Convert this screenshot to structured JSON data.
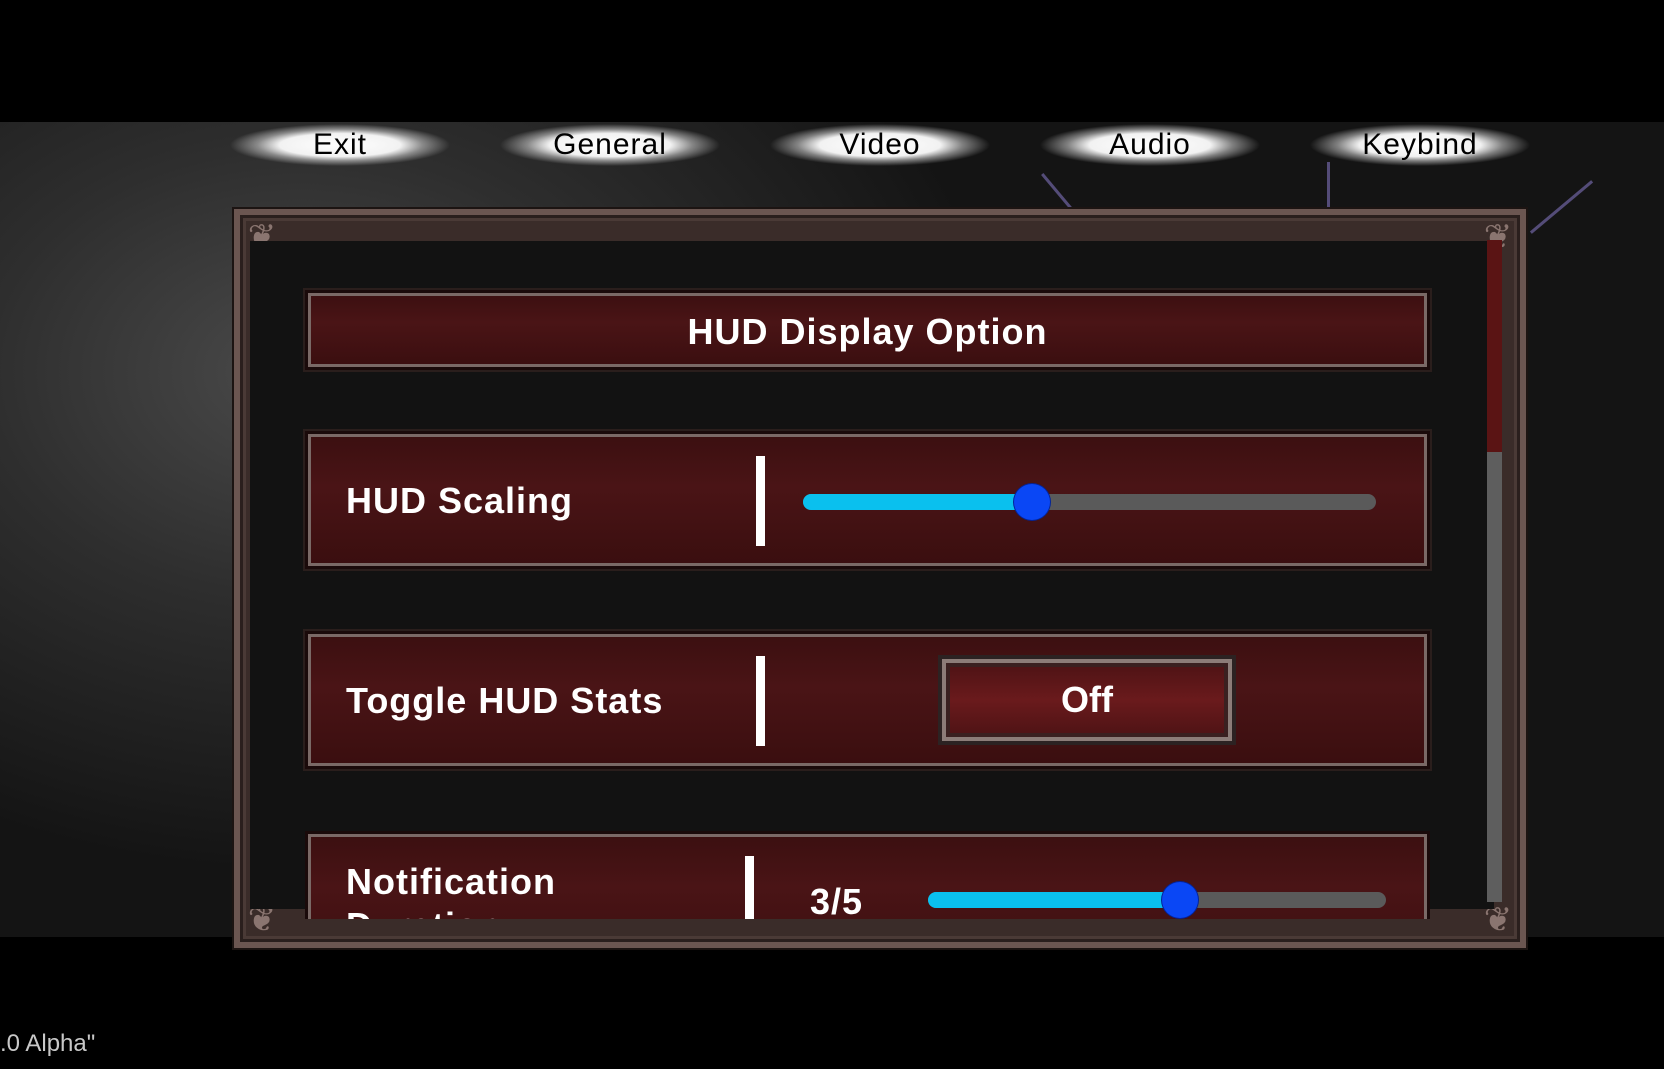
{
  "tabs": [
    "Exit",
    "General",
    "Video",
    "Audio",
    "Keybind"
  ],
  "section": {
    "title": "HUD Display Option"
  },
  "settings": {
    "hud_scaling": {
      "label": "HUD Scaling",
      "value_fraction": 0.4
    },
    "toggle_hud_stats": {
      "label": "Toggle HUD Stats",
      "button": "Off"
    },
    "notification_duration": {
      "label": "Notification Duration",
      "value_text": "3/5",
      "value_fraction": 0.55
    }
  },
  "scrollbar": {
    "position_fraction": 0.0
  },
  "version_text": ".0 Alpha\"",
  "colors": {
    "slider_fill": "#0ac0ee",
    "slider_knob": "#0a47f5",
    "row_bg": "#4a1416",
    "scroll_thumb": "#5a1414"
  }
}
